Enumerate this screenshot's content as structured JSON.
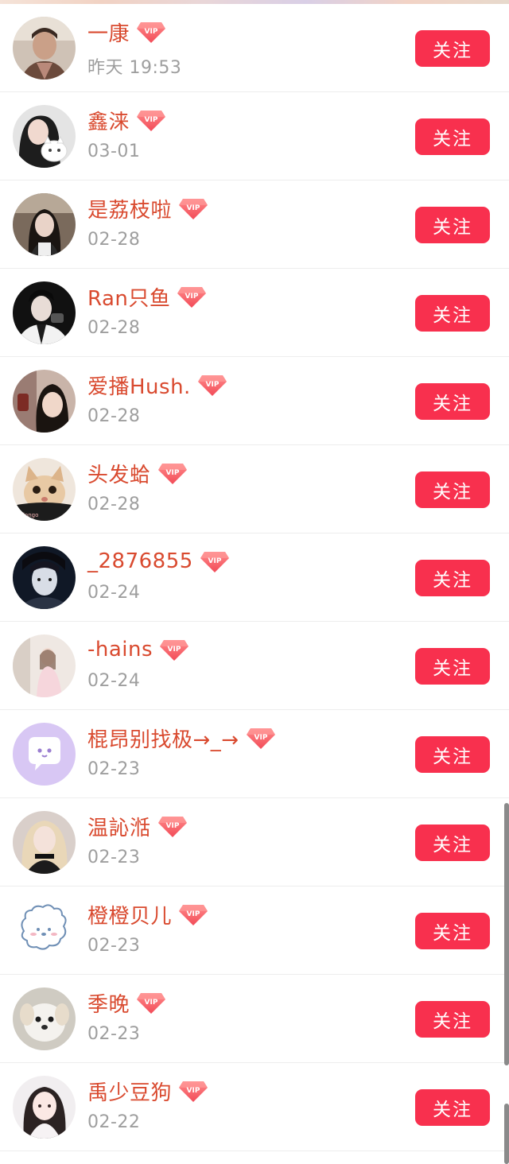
{
  "follow_list": {
    "follow_label": "关注",
    "vip_label": "VIP",
    "accent_color": "#f8304e",
    "name_color": "#d94a2f",
    "items": [
      {
        "name": "一康",
        "date": "昨天 19:53",
        "avatar": "avatar-photo-man"
      },
      {
        "name": "鑫涞",
        "date": "03-01",
        "avatar": "avatar-photo-girl-with-cat"
      },
      {
        "name": "是荔枝啦",
        "date": "02-28",
        "avatar": "avatar-photo-girl"
      },
      {
        "name": "Ran只鱼",
        "date": "02-28",
        "avatar": "avatar-photo-man-dark"
      },
      {
        "name": "爱播Hush.",
        "date": "02-28",
        "avatar": "avatar-photo-girl-selfie"
      },
      {
        "name": "头发蛤",
        "date": "02-28",
        "avatar": "avatar-photo-cat"
      },
      {
        "name": "_2876855",
        "date": "02-24",
        "avatar": "avatar-photo-man-blue"
      },
      {
        "name": "-hains",
        "date": "02-24",
        "avatar": "avatar-photo-girl-room"
      },
      {
        "name": "棍昂别找极→_→",
        "date": "02-23",
        "avatar": "avatar-default-chat-bubble"
      },
      {
        "name": "温訫湉",
        "date": "02-23",
        "avatar": "avatar-photo-girl-blonde"
      },
      {
        "name": "橙橙贝儿",
        "date": "02-23",
        "avatar": "avatar-drawing-dog"
      },
      {
        "name": "季晚",
        "date": "02-23",
        "avatar": "avatar-photo-puppy"
      },
      {
        "name": "禹少豆狗",
        "date": "02-22",
        "avatar": "avatar-photo-girl-anime-style"
      }
    ]
  }
}
